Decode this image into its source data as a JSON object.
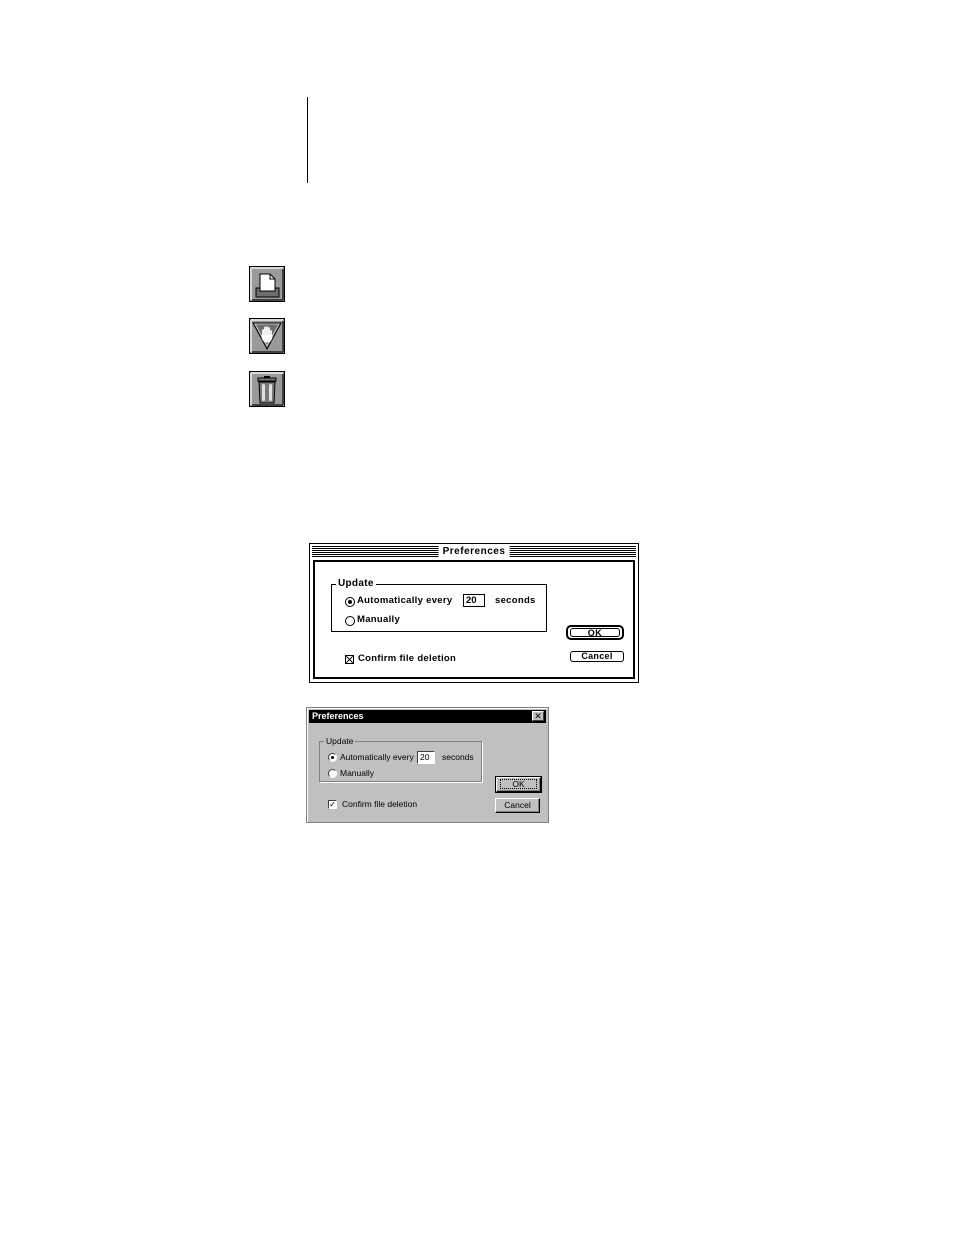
{
  "toolbar": {
    "icons": [
      "print-icon",
      "hold-icon",
      "trash-icon"
    ]
  },
  "mac_dialog": {
    "title": "Preferences",
    "group_label": "Update",
    "auto_label": "Automatically every",
    "interval_value": "20",
    "seconds_label": "seconds",
    "manual_label": "Manually",
    "confirm_label": "Confirm file deletion",
    "ok_label": "OK",
    "cancel_label": "Cancel",
    "auto_selected": true,
    "confirm_checked": true
  },
  "win_dialog": {
    "title": "Preferences",
    "close_glyph": "✕",
    "group_label": "Update",
    "auto_label": "Automatically every",
    "interval_value": "20",
    "seconds_label": "seconds",
    "manual_label": "Manually",
    "confirm_label": "Confirm file deletion",
    "check_glyph": "✓",
    "ok_label": "OK",
    "cancel_label": "Cancel",
    "auto_selected": true,
    "confirm_checked": true
  }
}
